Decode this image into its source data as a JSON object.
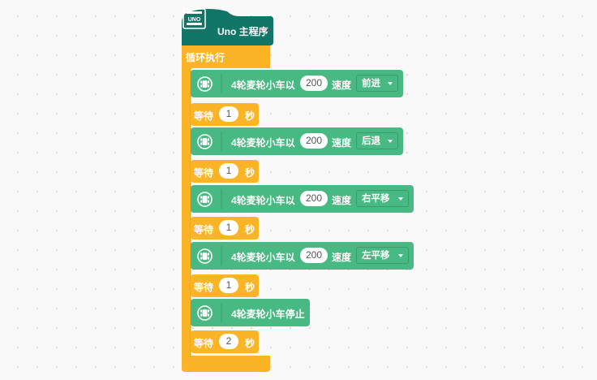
{
  "colors": {
    "hat": "#117567",
    "loop": "#fcb427",
    "motion": "#49b984",
    "canvas": "#f9f9f9"
  },
  "hat": {
    "title": "Uno 主程序",
    "badge_text": "UNO",
    "icon": "arduino-uno-board-icon"
  },
  "loop": {
    "label": "循环执行"
  },
  "blocks": [
    {
      "type": "motor_move",
      "label": "4轮麦轮小车以",
      "speed": "200",
      "speed_label": "速度",
      "direction": "前进",
      "icon": "car-icon"
    },
    {
      "type": "wait",
      "label": "等待",
      "seconds": "1",
      "unit": "秒"
    },
    {
      "type": "motor_move",
      "label": "4轮麦轮小车以",
      "speed": "200",
      "speed_label": "速度",
      "direction": "后退",
      "icon": "car-icon"
    },
    {
      "type": "wait",
      "label": "等待",
      "seconds": "1",
      "unit": "秒"
    },
    {
      "type": "motor_move",
      "label": "4轮麦轮小车以",
      "speed": "200",
      "speed_label": "速度",
      "direction": "右平移",
      "icon": "car-icon"
    },
    {
      "type": "wait",
      "label": "等待",
      "seconds": "1",
      "unit": "秒"
    },
    {
      "type": "motor_move",
      "label": "4轮麦轮小车以",
      "speed": "200",
      "speed_label": "速度",
      "direction": "左平移",
      "icon": "car-icon"
    },
    {
      "type": "wait",
      "label": "等待",
      "seconds": "1",
      "unit": "秒"
    },
    {
      "type": "motor_stop",
      "label": "4轮麦轮小车停止",
      "icon": "car-icon"
    },
    {
      "type": "wait",
      "label": "等待",
      "seconds": "2",
      "unit": "秒"
    }
  ]
}
